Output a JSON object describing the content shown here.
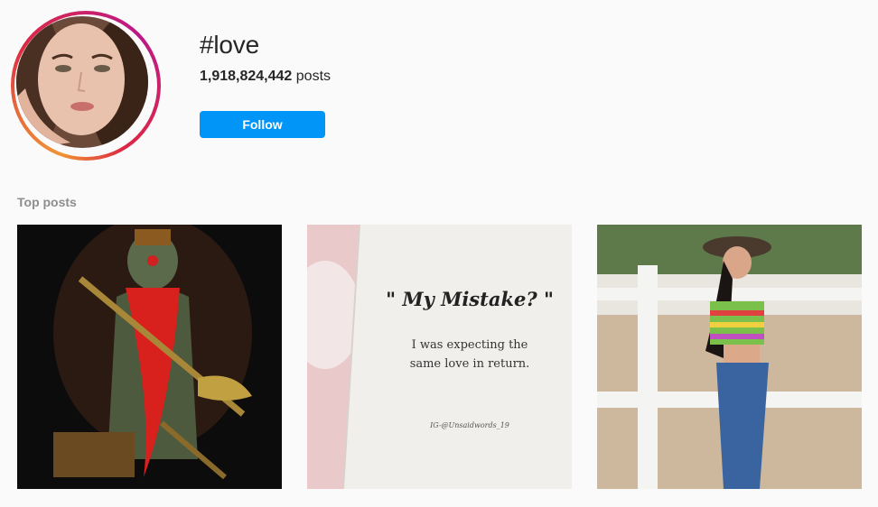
{
  "hashtag": {
    "title": "#love",
    "post_count": "1,918,824,442",
    "post_count_suffix": " posts",
    "follow_label": "Follow"
  },
  "top_posts": {
    "label": "Top posts",
    "quote_post": {
      "title": "\" My Mistake? \"",
      "body_line1": "I was expecting the",
      "body_line2": "same love in return.",
      "credit": "IG-@Unsaidwords_19"
    }
  },
  "colors": {
    "follow_button": "#0095f6",
    "background": "#fafafa",
    "muted_text": "#8e8e8e"
  }
}
